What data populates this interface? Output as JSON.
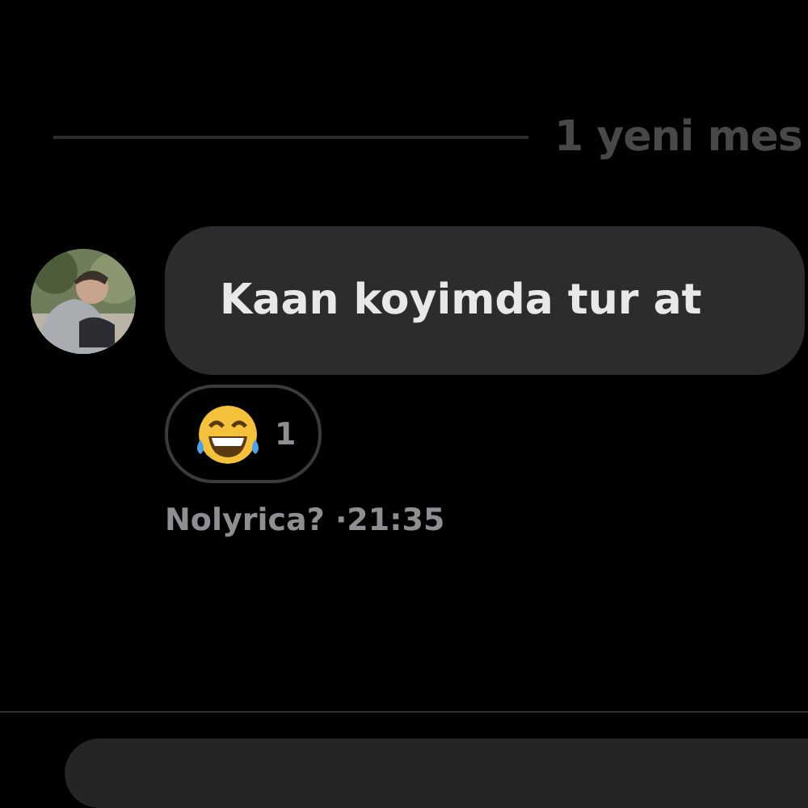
{
  "new_messages_divider": {
    "label": "1 yeni mes"
  },
  "message": {
    "text": "Kaan koyimda tur at",
    "reactions": [
      {
        "kind": "laughing",
        "count": "1"
      }
    ],
    "sender": "Nolyrica?",
    "time": "·21:35"
  }
}
